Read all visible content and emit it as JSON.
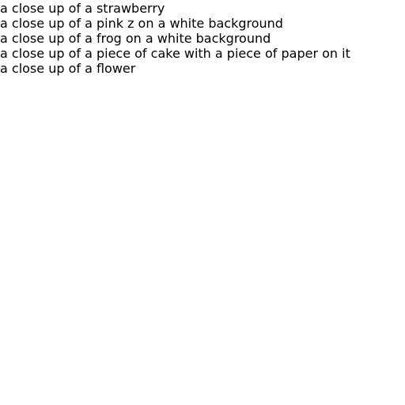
{
  "captions": [
    "a close up of a strawberry",
    "a close up of a pink z on a white background",
    "a close up of a frog on a white background",
    "a close up of a piece of cake with a piece of paper on it",
    "a close up of a flower"
  ]
}
